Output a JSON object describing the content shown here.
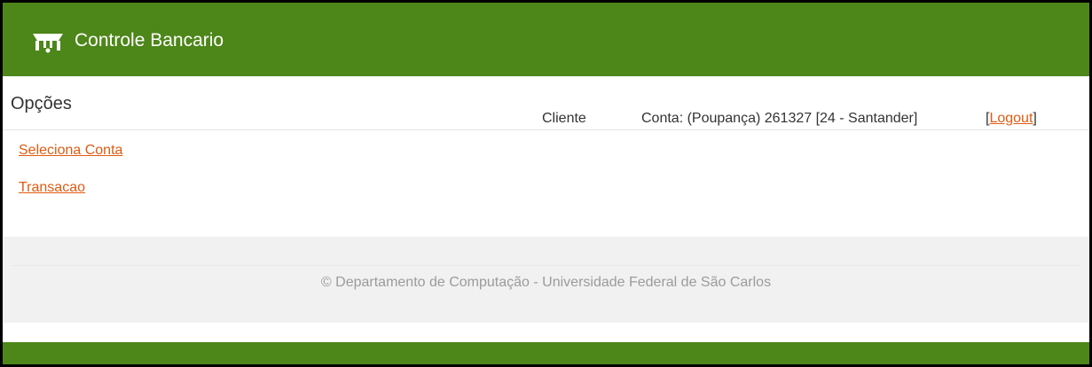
{
  "header": {
    "title": "Controle Bancario",
    "logo_icon": "bank-logo-icon"
  },
  "main": {
    "options_title": "Opções",
    "client_label": "Cliente",
    "account_info": "Conta: (Poupança) 261327 [24 - Santander]",
    "logout": {
      "prefix": "[",
      "label": "Logout",
      "suffix": "]"
    },
    "links": [
      {
        "label": "Seleciona Conta"
      },
      {
        "label": "Transacao"
      }
    ]
  },
  "footer": {
    "copyright": "© Departamento de Computação - Universidade Federal de São Carlos"
  },
  "colors": {
    "brand_green": "#4d8619",
    "link_orange": "#e05a12",
    "footer_bg": "#f1f1f1"
  }
}
